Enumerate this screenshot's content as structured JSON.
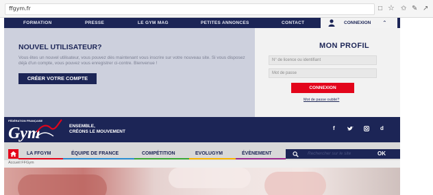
{
  "browser": {
    "url": "ffgym.fr"
  },
  "top_nav": {
    "items": [
      "FORMATION",
      "PRESSE",
      "LE GYM MAG",
      "PETITES ANNONCES",
      "CONTACT"
    ],
    "connexion_label": "CONNEXION"
  },
  "new_user": {
    "title": "NOUVEL UTILISATEUR?",
    "text": "Vous êtes un nouvel utilisateur, vous pouvez dès maintenant vous inscrire sur votre nouveau site. Si vous disposez déjà d'un compte, vous pouvez vous enregistrer ci-contre. Bienvenue !",
    "create_button": "CRÉER VOTRE COMPTE"
  },
  "profile": {
    "title": "MON PROFIL",
    "licence_placeholder": "N° de licence ou identifiant",
    "password_placeholder": "Mot de passe",
    "login_button": "CONNEXION",
    "forgot_link": "Mot de passe oublié?"
  },
  "brand": {
    "logo_small_text": "FÉDÉRATION FRANÇAISE",
    "logo_text": "Gym",
    "tagline_line1": "ENSEMBLE,",
    "tagline_line2": "CRÉONS LE MOUVEMENT",
    "social": [
      "f",
      "d"
    ]
  },
  "main_nav": {
    "items": [
      "LA FFGYM",
      "ÉQUIPE DE FRANCE",
      "COMPÉTITION",
      "EVOLUGYM",
      "ÉVÈNEMENT"
    ],
    "search_placeholder": "Rechercher sur le site",
    "search_button": "OK"
  },
  "breadcrumb": "Accueil FFGym",
  "colors": {
    "navy": "#1c2556",
    "red": "#e3051b",
    "panel_left": "#cdd0dd",
    "nav_accents": [
      "#e3051b",
      "#2a8fd1",
      "#3aa935",
      "#f7b400",
      "#9c2a8f"
    ]
  },
  "icons": {
    "star": "star-icon",
    "bookmark": "bookmark-icon",
    "user": "user-icon",
    "home": "home-icon",
    "search": "search-icon",
    "twitter": "twitter-icon",
    "instagram": "instagram-icon"
  }
}
